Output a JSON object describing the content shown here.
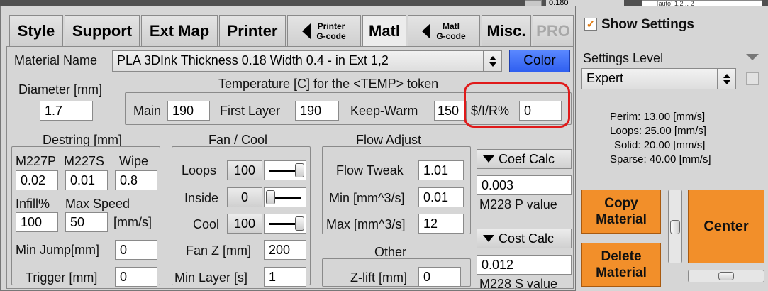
{
  "tabs": [
    {
      "label": "Style"
    },
    {
      "label": "Support"
    },
    {
      "label": "Ext Map"
    },
    {
      "label": "Printer"
    },
    {
      "line1": "Printer",
      "line2": "G-code"
    },
    {
      "label": "Matl"
    },
    {
      "line1": "Matl",
      "line2": "G-code"
    },
    {
      "label": "Misc."
    },
    {
      "label": "PRO"
    }
  ],
  "top_partial": {
    "value": "0.180",
    "field": "[auto] 1.2 .. 2"
  },
  "material": {
    "name_label": "Material Name",
    "name_value": "PLA 3DInk Thickness 0.18 Width 0.4 - in Ext 1,2",
    "color_button": "Color"
  },
  "diameter": {
    "label": "Diameter [mm]",
    "value": "1.7"
  },
  "temperature": {
    "title": "Temperature [C] for the <TEMP> token",
    "main_label": "Main",
    "main_value": "190",
    "first_label": "First Layer",
    "first_value": "190",
    "keep_label": "Keep-Warm",
    "keep_value": "150",
    "sir_label": "$/I/R%",
    "sir_value": "0"
  },
  "destring": {
    "title": "Destring [mm]",
    "m227p_label": "M227P",
    "m227s_label": "M227S",
    "wipe_label": "Wipe",
    "m227p_value": "0.02",
    "m227s_value": "0.01",
    "wipe_value": "0.8",
    "infill_label": "Infill%",
    "maxspeed_label": "Max Speed",
    "infill_value": "100",
    "maxspeed_value": "50",
    "speed_unit": "[mm/s]",
    "minjump_label": "Min Jump[mm]",
    "minjump_value": "0",
    "trigger_label": "Trigger [mm]",
    "trigger_value": "0"
  },
  "fan": {
    "title": "Fan / Cool",
    "loops_label": "Loops",
    "loops_value": "100",
    "loops_level": 1.0,
    "inside_label": "Inside",
    "inside_value": "0",
    "inside_level": 0.0,
    "cool_label": "Cool",
    "cool_value": "100",
    "cool_level": 1.0,
    "fanz_label": "Fan Z [mm]",
    "fanz_value": "200",
    "minlayer_label": "Min Layer [s]",
    "minlayer_value": "1"
  },
  "flow": {
    "title": "Flow Adjust",
    "tweak_label": "Flow Tweak",
    "tweak_value": "1.01",
    "min_label": "Min [mm^3/s]",
    "min_value": "0.01",
    "max_label": "Max [mm^3/s]",
    "max_value": "12"
  },
  "other": {
    "title": "Other",
    "zlift_label": "Z-lift [mm]",
    "zlift_value": "0"
  },
  "coef": {
    "button": "Coef Calc",
    "value": "0.003",
    "label": "M228 P value"
  },
  "cost": {
    "button": "Cost Calc",
    "value": "0.012",
    "label": "M228 S value"
  },
  "settings": {
    "show_label": "Show Settings",
    "level_label": "Settings Level",
    "level_value": "Expert"
  },
  "speeds": [
    "Perim:  13.00 [mm/s]",
    "Loops:  25.00 [mm/s]",
    "Solid:  20.00 [mm/s]",
    "Sparse: 40.00 [mm/s]"
  ],
  "actions": {
    "copy_l1": "Copy",
    "copy_l2": "Material",
    "delete_l1": "Delete",
    "delete_l2": "Material",
    "center": "Center"
  },
  "colors": {
    "accent_orange": "#f28f2a",
    "highlight_red": "#e01a1a",
    "color_button": "#3a6ff7"
  }
}
